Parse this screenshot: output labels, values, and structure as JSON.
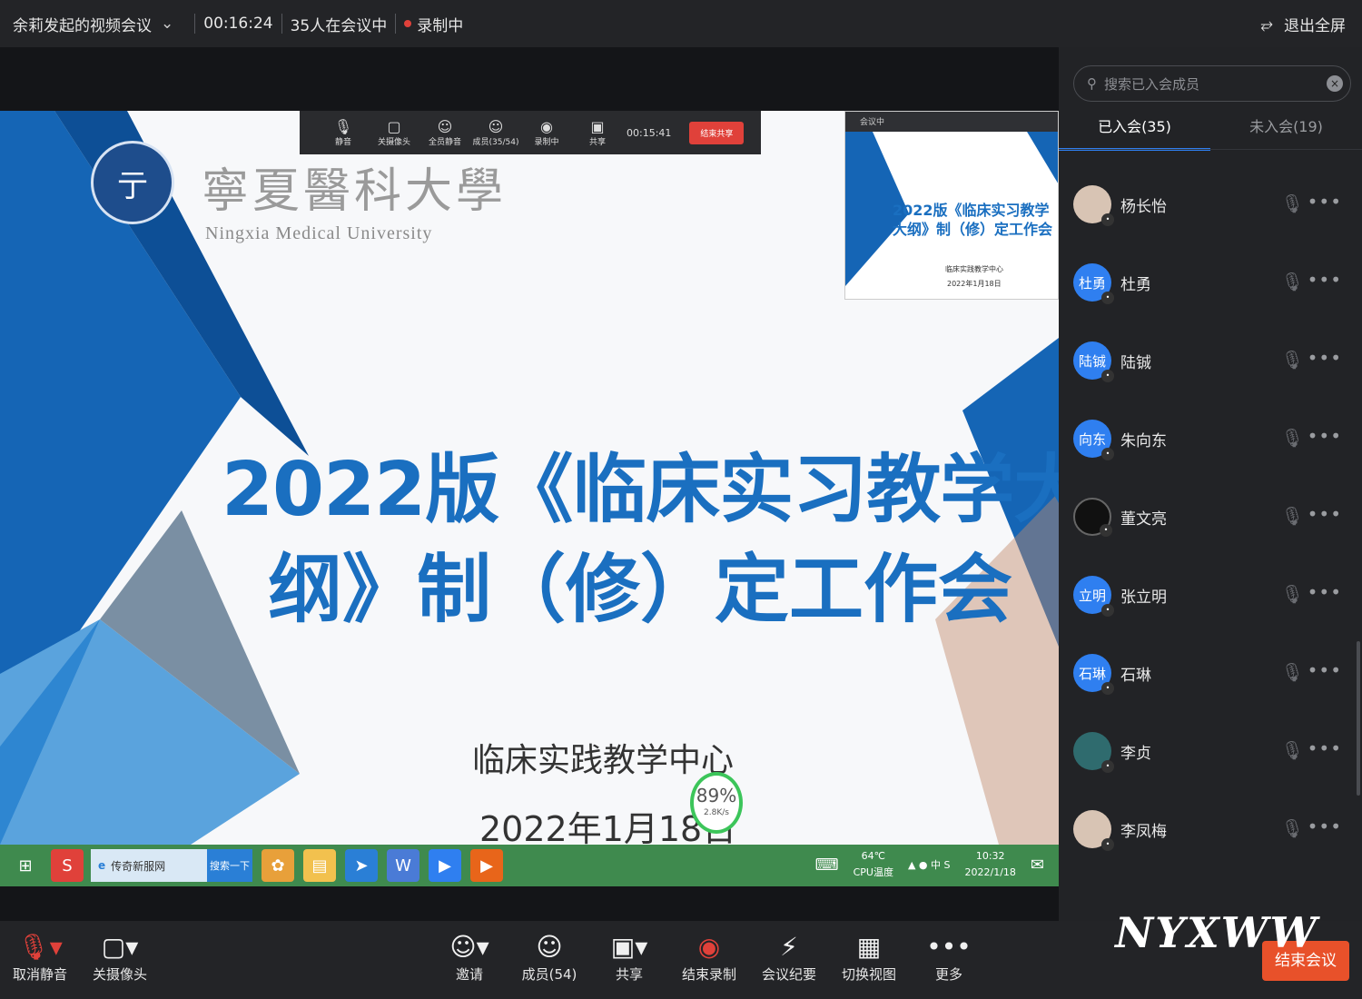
{
  "topbar": {
    "meeting_title": "余莉发起的视频会议",
    "duration": "00:16:24",
    "attendees": "35人在会议中",
    "recording": "录制中",
    "exit_fullscreen": "退出全屏"
  },
  "slide": {
    "univ_cn": "寧夏醫科大學",
    "univ_en": "Ningxia Medical University",
    "title_line1": "2022版《临床实习教学大",
    "title_line2": "纲》制（修）定工作会",
    "department": "临床实践教学中心",
    "date": "2022年1月18日",
    "net_percent": "89%",
    "net_speed": "2.8K/s"
  },
  "shared_toolbar": {
    "items": [
      "静音",
      "关摄像头",
      "全员静音",
      "成员(35/54)",
      "录制中",
      "共享"
    ],
    "time": "00:15:41",
    "end_share": "结束共享"
  },
  "pip": {
    "label": "会议中",
    "title": "2022版《临床实习教学大纲》制（修）定工作会",
    "dept": "临床实践教学中心",
    "date": "2022年1月18日"
  },
  "taskbar": {
    "ie_label": "传奇新服网",
    "search_label": "搜索一下",
    "temp": "64℃",
    "cpu": "CPU温度",
    "time": "10:32",
    "date": "2022/1/18"
  },
  "panel": {
    "search_placeholder": "搜索已入会成员",
    "tab_joined": "已入会(35)",
    "tab_not_joined": "未入会(19)",
    "participants": [
      {
        "avatar": "",
        "name": "杨长怡"
      },
      {
        "avatar": "杜勇",
        "name": "杜勇"
      },
      {
        "avatar": "陆铖",
        "name": "陆铖"
      },
      {
        "avatar": "向东",
        "name": "朱向东"
      },
      {
        "avatar": "",
        "name": "董文亮"
      },
      {
        "avatar": "立明",
        "name": "张立明"
      },
      {
        "avatar": "石琳",
        "name": "石琳"
      },
      {
        "avatar": "",
        "name": "李贞"
      },
      {
        "avatar": "",
        "name": "李凤梅"
      }
    ]
  },
  "bottom": {
    "unmute": "取消静音",
    "camera_off": "关摄像头",
    "invite": "邀请",
    "members": "成员(54)",
    "share": "共享",
    "end_record": "结束录制",
    "minutes": "会议纪要",
    "switch_view": "切换视图",
    "more": "更多",
    "end_meeting": "结束会议"
  },
  "watermark": "NYXWW",
  "colors": {
    "accent": "#2f7ff0",
    "slide_blue": "#1a6fc0",
    "end_red": "#e8512a"
  }
}
